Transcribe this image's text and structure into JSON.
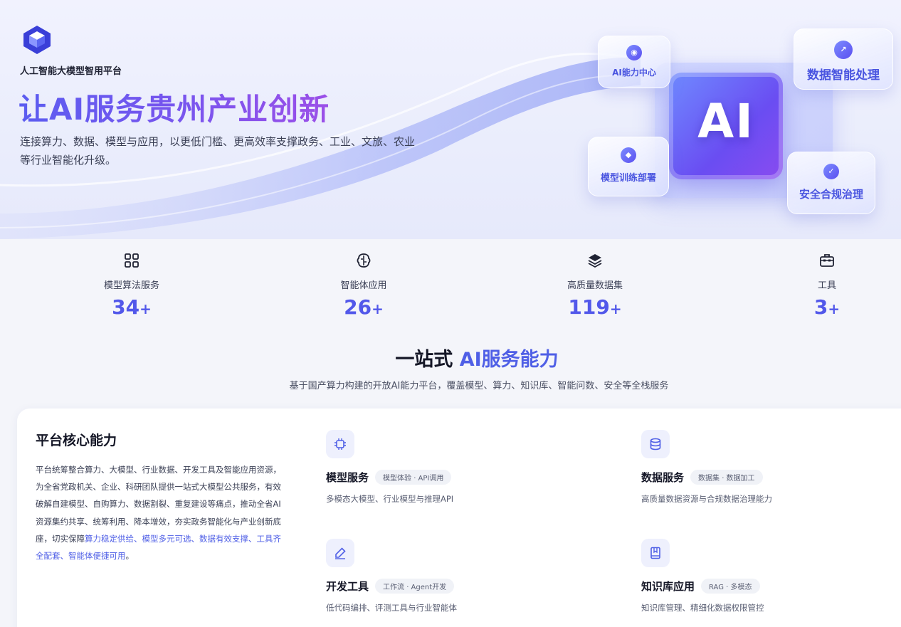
{
  "brand": {
    "name": "人工智能大模型智用平台",
    "logo_icon": "cube-logo-icon"
  },
  "hero": {
    "title": "让AI服务贵州产业创新",
    "subtitle": "连接算力、数据、模型与应用，以更低门槛、更高效率支撑政务、工业、文旅、农业等行业智能化升级。",
    "illustration": {
      "chip_text": "AI",
      "bubbles": [
        {
          "label": "AI能力中心",
          "icon": "robot-icon"
        },
        {
          "label": "数据智能处理",
          "icon": "chart-line-icon"
        },
        {
          "label": "模型训练部署",
          "icon": "cube-icon"
        },
        {
          "label": "安全合规治理",
          "icon": "shield-check-icon"
        }
      ]
    }
  },
  "stats": [
    {
      "label": "模型算法服务",
      "value": "34",
      "suffix": "+",
      "icon": "grid-apps-icon"
    },
    {
      "label": "智能体应用",
      "value": "26",
      "suffix": "+",
      "icon": "brain-icon"
    },
    {
      "label": "高质量数据集",
      "value": "119",
      "suffix": "+",
      "icon": "layers-icon"
    },
    {
      "label": "工具",
      "value": "3",
      "suffix": "+",
      "icon": "toolbox-icon"
    }
  ],
  "section": {
    "title_prefix": "一站式",
    "title_accent": "AI服务能力",
    "subtitle": "基于国产算力构建的开放AI能力平台，覆盖模型、算力、知识库、智能问数、安全等全栈服务"
  },
  "core": {
    "title": "平台核心能力",
    "desc_plain": "平台统筹整合算力、大模型、行业数据、开发工具及智能应用资源，为全省党政机关、企业、科研团队提供一站式大模型公共服务，有效破解自建模型、自购算力、数据割裂、重复建设等痛点，推动全省AI资源集约共享、统筹利用、降本增效，夯实政务智能化与产业创新底座，切实保障",
    "desc_highlight": "算力稳定供给、模型多元可选、数据有效支撑、工具齐全配套、智能体便捷可用",
    "desc_end": "。",
    "features": [
      {
        "name": "模型服务",
        "tag": "模型体验 · API调用",
        "desc": "多模态大模型、行业模型与推理API",
        "icon": "chip-icon"
      },
      {
        "name": "数据服务",
        "tag": "数据集 · 数据加工",
        "desc": "高质量数据资源与合规数据治理能力",
        "icon": "database-icon"
      },
      {
        "name": "开发工具",
        "tag": "工作流 · Agent开发",
        "desc": "低代码编排、评测工具与行业智能体",
        "icon": "pen-icon"
      },
      {
        "name": "知识库应用",
        "tag": "RAG · 多模态",
        "desc": "知识库管理、精细化数据权限管控",
        "icon": "book-icon"
      }
    ]
  },
  "colors": {
    "accent": "#5258ea",
    "title_gradient_start": "#5b5cf0",
    "title_gradient_end": "#9b4fe8"
  }
}
